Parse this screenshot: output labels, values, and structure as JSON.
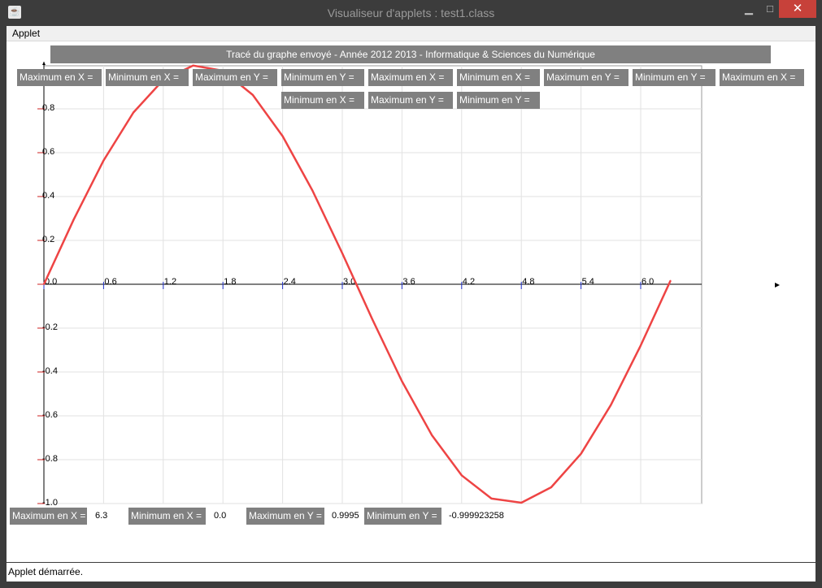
{
  "window": {
    "title": "Visualiseur d'applets : test1.class",
    "app_icon": "java-icon",
    "min_glyph": "▁",
    "max_glyph": "□",
    "close_glyph": "✕"
  },
  "menu": {
    "applet_label": "Applet"
  },
  "banner": "Tracé du graphe envoyé  -  Année 2012 2013  -  Informatique & Sciences du Numérique",
  "top_labels_row1": [
    "Maximum en X =",
    "Minimum en X =",
    "Maximum en Y =",
    "Minimum en Y =",
    "Maximum en X =",
    "Minimum en X =",
    "Maximum en Y =",
    "Minimum en Y =",
    "Maximum en X ="
  ],
  "top_labels_row2": [
    "Minimum en X =",
    "Maximum en Y =",
    "Minimum en Y ="
  ],
  "bottom_stats": {
    "max_x_label": "Maximum en X =",
    "max_x_value": "6.3",
    "min_x_label": "Minimum en X =",
    "min_x_value": "0.0",
    "max_y_label": "Maximum en Y =",
    "max_y_value": "0.9995",
    "min_y_label": "Minimum en Y =",
    "min_y_value": "-0.999923258"
  },
  "status_text": "Applet démarrée.",
  "chart_data": {
    "type": "line",
    "title": "",
    "xlabel": "",
    "ylabel": "",
    "xlim": [
      0,
      6.6
    ],
    "ylim": [
      -1.0,
      1.0
    ],
    "x_ticks": [
      "0.0",
      "0.6",
      "1.2",
      "1.8",
      "2.4",
      "3.0",
      "3.6",
      "4.2",
      "4.8",
      "5.4",
      "6.0"
    ],
    "y_ticks": [
      "0.8",
      "0.6",
      "0.4",
      "0.2",
      "-0.2",
      "-0.4",
      "-0.6",
      "-0.8",
      "-1.0"
    ],
    "y_tick_values": [
      0.8,
      0.6,
      0.4,
      0.2,
      -0.2,
      -0.4,
      -0.6,
      -0.8,
      -1.0
    ],
    "grid": true,
    "series": [
      {
        "color": "#ee4444",
        "x": [
          0.0,
          0.3,
          0.6,
          0.9,
          1.2,
          1.5,
          1.8,
          2.1,
          2.4,
          2.7,
          3.0,
          3.3,
          3.6,
          3.9,
          4.2,
          4.5,
          4.8,
          5.1,
          5.4,
          5.7,
          6.0,
          6.3
        ],
        "y": [
          0.0,
          0.2955,
          0.5646,
          0.7833,
          0.932,
          0.9975,
          0.9738,
          0.8632,
          0.6755,
          0.4274,
          0.1411,
          -0.1577,
          -0.4425,
          -0.6878,
          -0.8716,
          -0.9775,
          -0.9962,
          -0.9258,
          -0.7728,
          -0.5507,
          -0.2794,
          0.0168
        ]
      }
    ]
  }
}
